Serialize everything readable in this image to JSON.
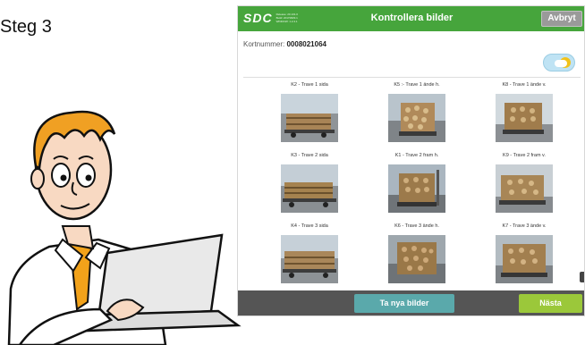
{
  "step_label": "Steg 3",
  "app": {
    "logo_text": "SDC",
    "meta_lines": [
      "Release: 20.101.0",
      "Build: 20170829.1",
      "WINDOW: 1.2.4.1"
    ],
    "title": "Kontrollera bilder",
    "abort_label": "Avbryt",
    "colors": {
      "header": "#46a53c",
      "footer": "#555555",
      "new_button": "#5aa9ab",
      "next_button": "#9bc83a"
    }
  },
  "card": {
    "label": "Kortnummer:",
    "value": "0008021064"
  },
  "lighting_toggle": {
    "icon": "sun-cloud-icon"
  },
  "photos": [
    {
      "caption": "K2 - Trave 1 sida"
    },
    {
      "caption": "K5 :- Trave 1 ände h."
    },
    {
      "caption": "K8 - Trave 1 ände v."
    },
    {
      "caption": "K3 - Trave 2 sida"
    },
    {
      "caption": "K1 - Trave 2 fram h."
    },
    {
      "caption": "K9 - Trave 2 fram v."
    },
    {
      "caption": "K4 - Trave 3 sida"
    },
    {
      "caption": "K6 - Trave 3 ände h."
    },
    {
      "caption": "K7 - Trave 3 ände v."
    }
  ],
  "footer": {
    "new_photos_label": "Ta nya bilder",
    "next_label": "Nästa"
  }
}
